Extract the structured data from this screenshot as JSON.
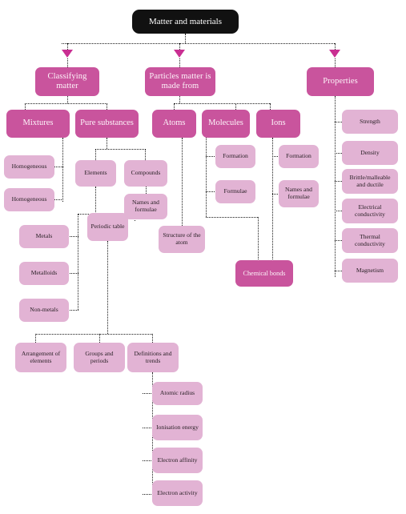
{
  "diagram": {
    "title": "Matter and materials",
    "type": "mind-map",
    "colors": {
      "root_bg": "#111111",
      "root_text": "#ffffff",
      "primary_node_bg": "#c9549d",
      "primary_node_text": "#fdf4f9",
      "secondary_node_bg": "#e2b3d4",
      "secondary_node_text": "#2a2126",
      "connector": "#1b1b1b",
      "arrow": "#c92f92",
      "background": "#ffffff"
    },
    "root": {
      "label": "Matter and materials"
    },
    "branches": [
      {
        "id": "classifying-matter",
        "label": "Classifying matter",
        "children": [
          {
            "id": "mixtures",
            "label": "Mixtures",
            "children": [
              {
                "id": "homogeneous-1",
                "label": "Homogeneous"
              },
              {
                "id": "homogeneous-2",
                "label": "Homogeneous"
              }
            ]
          },
          {
            "id": "pure-substances",
            "label": "Pure substances",
            "children": [
              {
                "id": "elements",
                "label": "Elements",
                "children": [
                  {
                    "id": "metals",
                    "label": "Metals"
                  },
                  {
                    "id": "metalloids",
                    "label": "Metalloids"
                  },
                  {
                    "id": "non-metals",
                    "label": "Non-metals"
                  },
                  {
                    "id": "periodic-table",
                    "label": "Periodic table",
                    "children": [
                      {
                        "id": "arrangement-of-elements",
                        "label": "Arrangement of elements"
                      },
                      {
                        "id": "groups-and-periods",
                        "label": "Groups and periods"
                      },
                      {
                        "id": "definitions-and-trends",
                        "label": "Definitions and trends",
                        "children": [
                          {
                            "id": "atomic-radius",
                            "label": "Atomic radius"
                          },
                          {
                            "id": "ionisation-energy",
                            "label": "Ionisation energy"
                          },
                          {
                            "id": "electron-affinity",
                            "label": "Electron affinity"
                          },
                          {
                            "id": "electron-activity",
                            "label": "Electron activity"
                          }
                        ]
                      }
                    ]
                  }
                ]
              },
              {
                "id": "compounds",
                "label": "Compounds",
                "children": [
                  {
                    "id": "compounds-names-and-formulae",
                    "label": "Names and formulae"
                  }
                ]
              }
            ]
          }
        ]
      },
      {
        "id": "particles-matter-is-made-from",
        "label": "Particles matter is made from",
        "children": [
          {
            "id": "atoms",
            "label": "Atoms",
            "children": [
              {
                "id": "structure-of-the-atom",
                "label": "Structure of the atom"
              }
            ]
          },
          {
            "id": "molecules",
            "label": "Molecules",
            "children": [
              {
                "id": "molecules-formation",
                "label": "Formation"
              },
              {
                "id": "molecules-formulae",
                "label": "Formulae"
              }
            ]
          },
          {
            "id": "ions",
            "label": "Ions",
            "children": [
              {
                "id": "ions-formation",
                "label": "Formation"
              },
              {
                "id": "ions-names-and-formulae",
                "label": "Names and formulae"
              }
            ]
          },
          {
            "id": "chemical-bonds",
            "label": "Chemical bonds"
          }
        ]
      },
      {
        "id": "properties",
        "label": "Properties",
        "children": [
          {
            "id": "strength",
            "label": "Strength"
          },
          {
            "id": "density",
            "label": "Density"
          },
          {
            "id": "brittle-malleable-and-ductile",
            "label": "Brittle/malleable and ductile"
          },
          {
            "id": "electrical-conductivity",
            "label": "Electrical conductivity"
          },
          {
            "id": "thermal-conductivity",
            "label": "Thermal conductivity"
          },
          {
            "id": "magnetism",
            "label": "Magnetism"
          }
        ]
      }
    ]
  }
}
